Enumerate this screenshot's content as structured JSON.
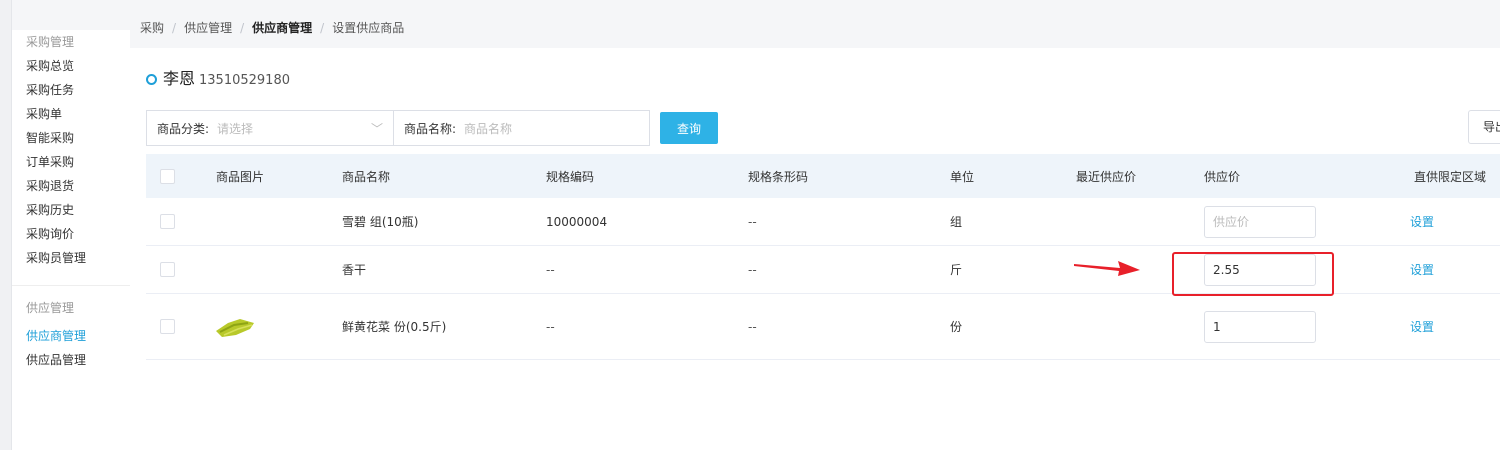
{
  "breadcrumb": {
    "c1": "采购",
    "c2": "供应管理",
    "c3": "供应商管理",
    "c4": "设置供应商品",
    "sep": "/"
  },
  "sidebar": {
    "group1_title": "采购管理",
    "group1_items": [
      "采购总览",
      "采购任务",
      "采购单",
      "智能采购",
      "订单采购",
      "采购退货",
      "采购历史",
      "采购询价",
      "采购员管理"
    ],
    "group2_title": "供应管理",
    "group2_items": [
      "供应商管理",
      "供应品管理"
    ]
  },
  "supplier": {
    "name": "李恩",
    "phone": "13510529180"
  },
  "filter": {
    "category_label": "商品分类:",
    "category_placeholder": "请选择",
    "name_label": "商品名称:",
    "name_placeholder": "商品名称",
    "query_label": "查询",
    "export_label": "导出"
  },
  "table": {
    "headers": {
      "image": "商品图片",
      "name": "商品名称",
      "spec_code": "规格编码",
      "barcode": "规格条形码",
      "unit": "单位",
      "recent_price": "最近供应价",
      "price": "供应价",
      "region": "直供限定区域"
    },
    "rows": [
      {
        "name": "雪碧 组(10瓶)",
        "spec_code": "10000004",
        "barcode": "--",
        "unit": "组",
        "price": "",
        "price_placeholder": "供应价",
        "action": "设置"
      },
      {
        "name": "香干",
        "spec_code": "--",
        "barcode": "--",
        "unit": "斤",
        "price": "2.55",
        "price_placeholder": "",
        "action": "设置"
      },
      {
        "name": "鲜黄花菜 份(0.5斤)",
        "spec_code": "--",
        "barcode": "--",
        "unit": "份",
        "price": "1",
        "price_placeholder": "",
        "action": "设置"
      }
    ]
  },
  "colors": {
    "accent": "#1e9fd8",
    "button": "#2eb2e6",
    "highlight": "#e8202a",
    "header_bg": "#eef4fa"
  }
}
